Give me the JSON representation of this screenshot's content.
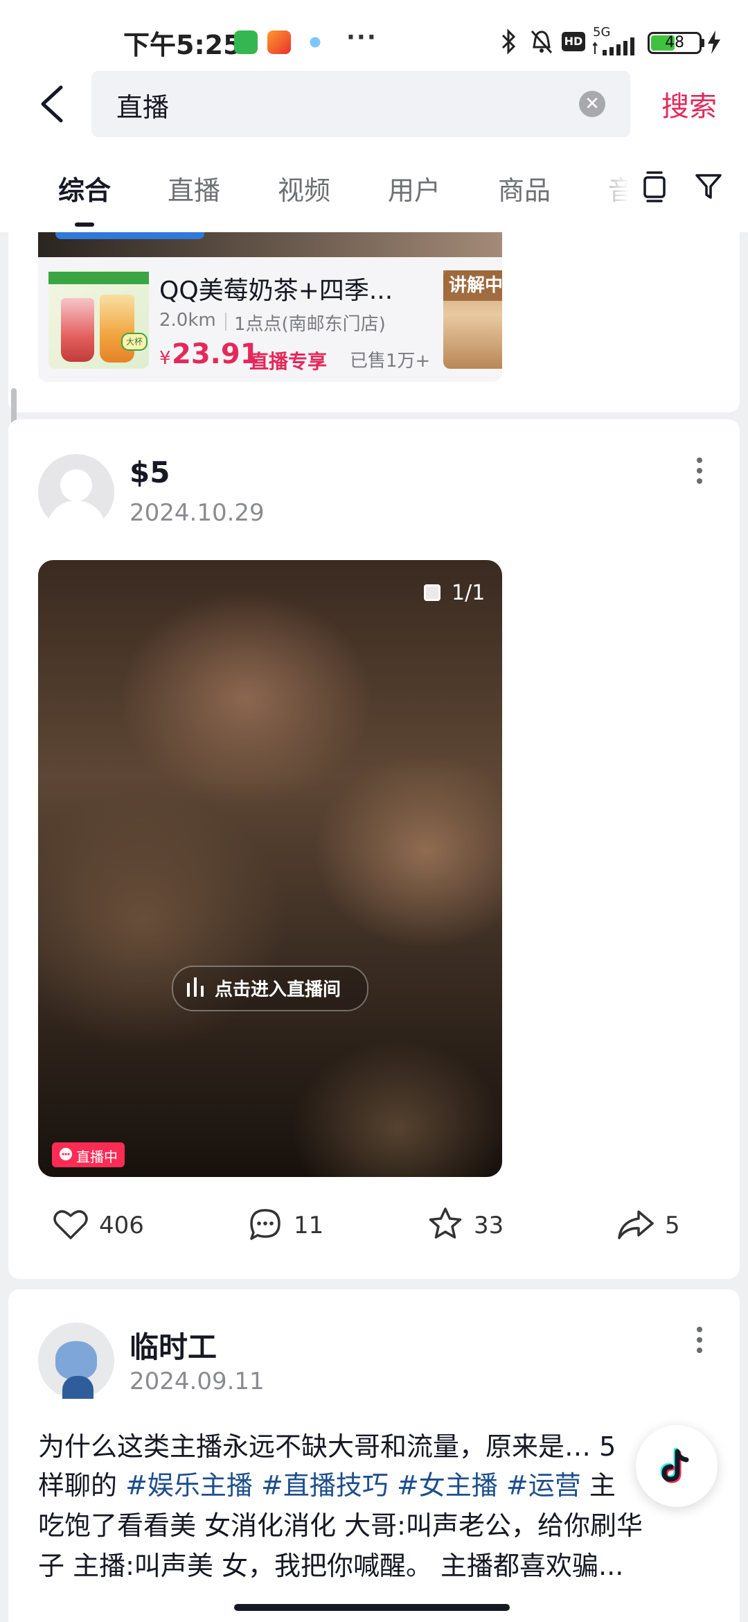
{
  "status_bar": {
    "time": "下午5:25",
    "network": "5G",
    "battery": "48",
    "more": "···"
  },
  "search": {
    "query": "直播",
    "submit_label": "搜索"
  },
  "tabs": [
    "综合",
    "直播",
    "视频",
    "用户",
    "商品",
    "音"
  ],
  "product_card": {
    "title": "QQ美莓奶茶+四季...",
    "distance": "2.0km",
    "store": "1点点(南邮东门店)",
    "currency": "¥",
    "price": "23.91",
    "exclusive_label": "直播专享",
    "sold": "已售1万+",
    "side_label": "讲解中"
  },
  "post1": {
    "username": "$5",
    "date": "2024.10.29",
    "page_indicator": "1/1",
    "enter_live_label": "点击进入直播间",
    "live_badge": "直播中",
    "likes": "406",
    "comments": "11",
    "favorites": "33",
    "shares": "5"
  },
  "post2": {
    "username": "临时工",
    "date": "2024.09.11",
    "line1": "为什么这类主播永远不缺大哥和流量，原来是…  5",
    "line2_prefix": "样聊的 ",
    "tags": [
      "#娱乐主播",
      "#直播技巧",
      "#女主播",
      "#运营"
    ],
    "line2_suffix": " 主",
    "line3": "吃饱了看看美 女消化消化 大哥:叫声老公，给你刷华",
    "line4": "子 主播:叫声美 女，我把你喊醒。 主播都喜欢骗..."
  },
  "colors": {
    "accent": "#e5285a",
    "live_red": "#fe2c55",
    "hashtag": "#1e4e8c",
    "muted": "#8a8b90"
  },
  "icons": [
    "back-arrow-icon",
    "clear-icon",
    "tab-layout-icon",
    "filter-icon",
    "more-vert-icon",
    "gallery-icon",
    "live-bars-icon",
    "heart-icon",
    "comment-icon",
    "star-icon",
    "share-icon",
    "douyin-logo-icon"
  ]
}
